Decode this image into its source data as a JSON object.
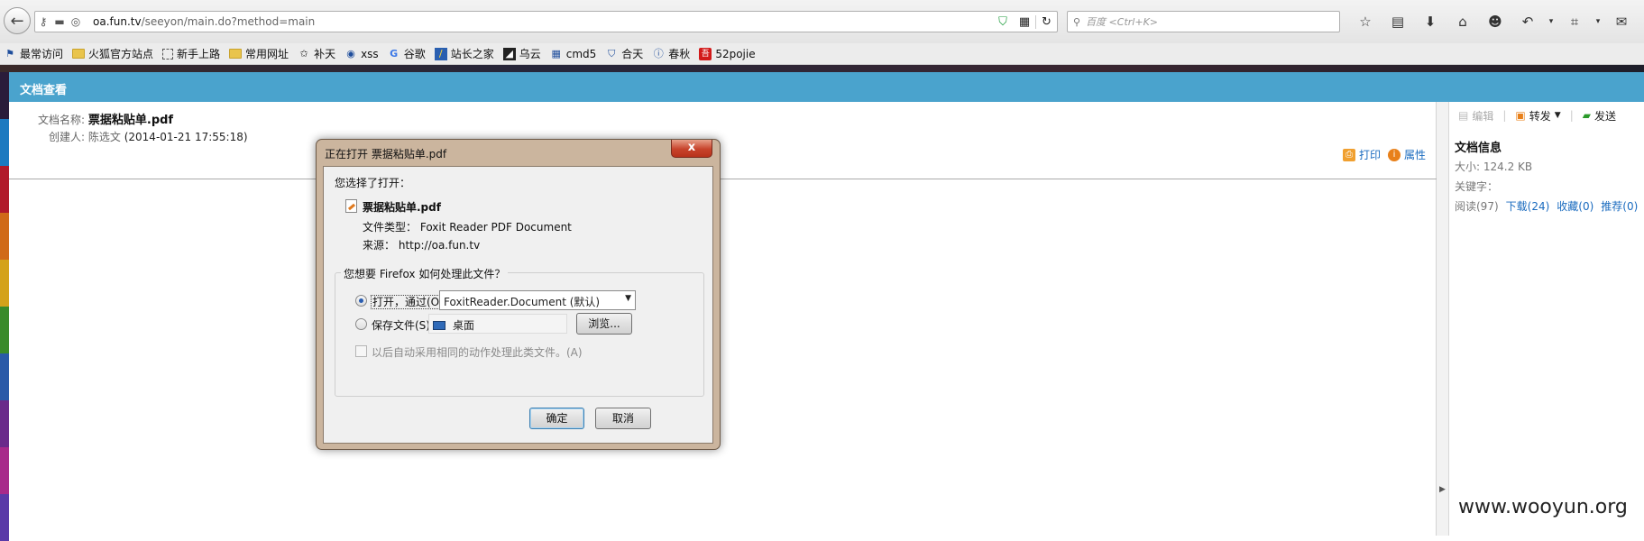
{
  "browser": {
    "url_host": "oa.fun.tv",
    "url_path": "/seeyon/main.do?method=main",
    "search_placeholder": "百度 <Ctrl+K>"
  },
  "bookmarks": [
    {
      "label": "最常访问",
      "icon": "bookmark-icon"
    },
    {
      "label": "火狐官方站点",
      "icon": "folder-icon"
    },
    {
      "label": "新手上路",
      "icon": "dashed-folder-icon"
    },
    {
      "label": "常用网址",
      "icon": "folder-icon"
    },
    {
      "label": "补天",
      "icon": "star-icon"
    },
    {
      "label": "xss",
      "icon": "globe-icon"
    },
    {
      "label": "谷歌",
      "icon": "google-icon"
    },
    {
      "label": "站长之家",
      "icon": "site-icon"
    },
    {
      "label": "乌云",
      "icon": "wooyun-icon"
    },
    {
      "label": "cmd5",
      "icon": "grid-icon"
    },
    {
      "label": "合天",
      "icon": "shield-icon"
    },
    {
      "label": "春秋",
      "icon": "i-icon"
    },
    {
      "label": "52pojie",
      "icon": "pojie-icon"
    }
  ],
  "oa": {
    "header_title": "文档查看",
    "doc_name_label": "文档名称:",
    "doc_name": "票据粘贴单.pdf",
    "creator_label": "创建人:",
    "creator_name": "陈选文",
    "created_time": "(2014-01-21 17:55:18)",
    "print_label": "打印",
    "props_label": "属性"
  },
  "right_panel": {
    "edit": "编辑",
    "forward": "转发",
    "send": "发送",
    "title": "文档信息",
    "size": "大小: 124.2 KB",
    "keywords": "关键字：",
    "read": "阅读(97)",
    "download": "下载(24)",
    "favorite": "收藏(0)",
    "recommend": "推荐(0)"
  },
  "watermark": "www.wooyun.org",
  "dialog": {
    "title": "正在打开 票据粘贴单.pdf",
    "close": "x",
    "chosen_label": "您选择了打开：",
    "file_name": "票据粘贴单.pdf",
    "file_type_label": "文件类型：",
    "file_type": "Foxit Reader PDF Document",
    "source_label": "来源：",
    "source": "http://oa.fun.tv",
    "question": "您想要 Firefox 如何处理此文件？",
    "open_with_label": "打开，通过(O)",
    "open_with_app": "FoxitReader.Document (默认)",
    "save_label": "保存文件(S)",
    "save_location": "桌面",
    "browse": "浏览...",
    "auto_label": "以后自动采用相同的动作处理此类文件。(A)",
    "ok": "确定",
    "cancel": "取消"
  }
}
